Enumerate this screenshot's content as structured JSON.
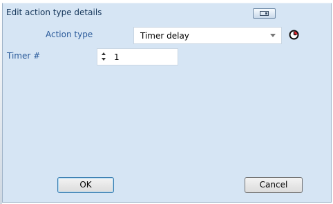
{
  "dialog": {
    "title": "Edit action type details",
    "title_button_icon": "restore-window-icon"
  },
  "form": {
    "action_type_label": "Action type",
    "action_type_value": "Timer delay",
    "action_type_icon": "clock-icon",
    "timer_label": "Timer #",
    "timer_value": "1"
  },
  "buttons": {
    "ok_label": "OK",
    "cancel_label": "Cancel"
  },
  "colors": {
    "dialog_bg": "#d6e5f4",
    "label_text": "#2a5a9a",
    "ok_border": "#3c7fb1"
  }
}
